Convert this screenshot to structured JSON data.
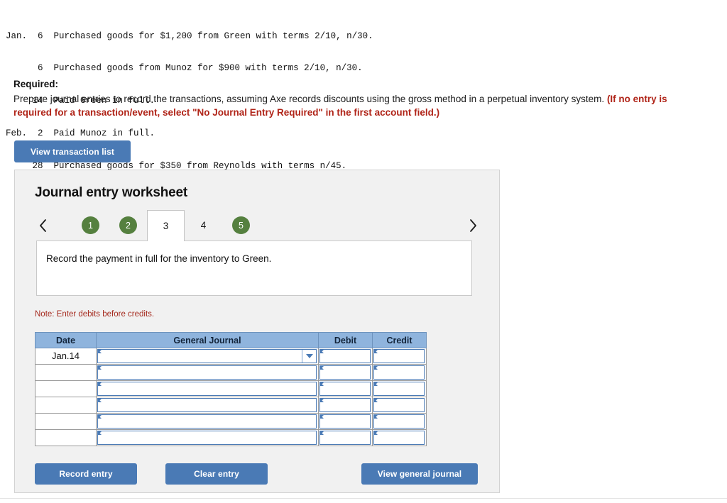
{
  "transactions": [
    {
      "month": "Jan.",
      "day": "6",
      "desc": "Purchased goods for $1,200 from Green with terms 2/10, n/30."
    },
    {
      "month": "",
      "day": "6",
      "desc": "Purchased goods from Munoz for $900 with terms 2/10, n/30."
    },
    {
      "month": "",
      "day": "14",
      "desc": "Paid Green in full."
    },
    {
      "month": "Feb.",
      "day": "2",
      "desc": "Paid Munoz in full."
    },
    {
      "month": "",
      "day": "28",
      "desc": "Purchased goods for $350 from Reynolds with terms n/45."
    }
  ],
  "required": {
    "title": "Required:",
    "body": "Prepare journal entries to record the transactions, assuming Axe records discounts using the gross method in a perpetual inventory system. ",
    "red_note": "(If no entry is required for a transaction/event, select \"No Journal Entry Required\" in the first account field.)"
  },
  "buttons": {
    "view_transaction_list": "View transaction list",
    "record_entry": "Record entry",
    "clear_entry": "Clear entry",
    "view_general_journal": "View general journal"
  },
  "worksheet": {
    "title": "Journal entry worksheet",
    "prev_icon": "chevron-left-icon",
    "next_icon": "chevron-right-icon",
    "tabs": [
      {
        "label": "1",
        "state": "done"
      },
      {
        "label": "2",
        "state": "done"
      },
      {
        "label": "3",
        "state": "active"
      },
      {
        "label": "4",
        "state": "plain"
      },
      {
        "label": "5",
        "state": "done"
      }
    ],
    "instruction": "Record the payment in full for the inventory to Green.",
    "note": "Note: Enter debits before credits."
  },
  "table": {
    "headers": [
      "Date",
      "General Journal",
      "Debit",
      "Credit"
    ],
    "rows": [
      {
        "date": "Jan.14",
        "general_journal": "",
        "debit": "",
        "credit": "",
        "dropdown": true
      },
      {
        "date": "",
        "general_journal": "",
        "debit": "",
        "credit": "",
        "dropdown": false
      },
      {
        "date": "",
        "general_journal": "",
        "debit": "",
        "credit": "",
        "dropdown": false
      },
      {
        "date": "",
        "general_journal": "",
        "debit": "",
        "credit": "",
        "dropdown": false
      },
      {
        "date": "",
        "general_journal": "",
        "debit": "",
        "credit": "",
        "dropdown": false
      },
      {
        "date": "",
        "general_journal": "",
        "debit": "",
        "credit": "",
        "dropdown": false
      }
    ]
  },
  "colors": {
    "button_blue": "#4a7ab5",
    "tab_green": "#55803f",
    "header_blue": "#8fb4dd",
    "warning_red": "#b02418",
    "note_red": "#a52a1e"
  }
}
